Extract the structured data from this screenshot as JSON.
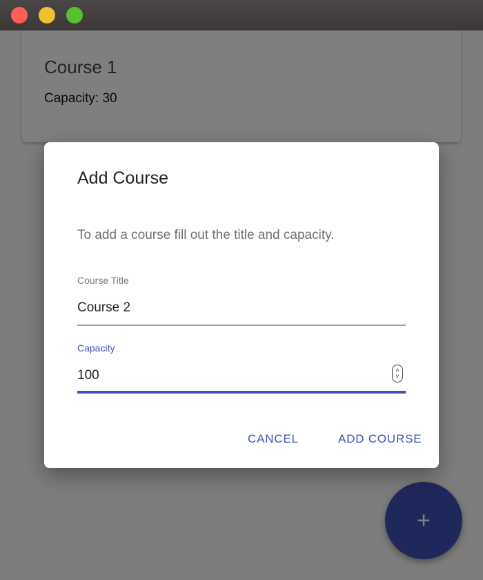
{
  "window": {
    "controls": [
      "close",
      "minimize",
      "maximize"
    ]
  },
  "course_card": {
    "title": "Course 1",
    "capacity": "Capacity: 30"
  },
  "fab": {
    "icon": "plus-icon",
    "glyph": "+"
  },
  "dialog": {
    "title": "Add Course",
    "text": "To add a course fill out the title and capacity.",
    "fields": {
      "title": {
        "label": "Course Title",
        "value": "Course 2"
      },
      "capacity": {
        "label": "Capacity",
        "value": "100"
      }
    },
    "actions": {
      "cancel": "CANCEL",
      "add": "ADD COURSE"
    }
  },
  "colors": {
    "accent": "#3f51b5",
    "scrim": "rgba(0,0,0,0.5)"
  }
}
